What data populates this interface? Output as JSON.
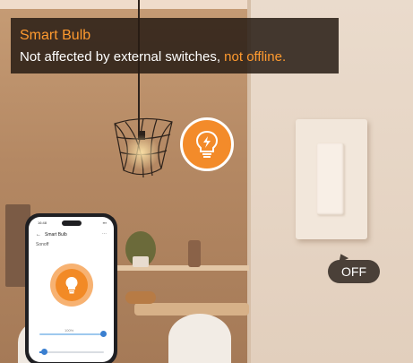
{
  "banner": {
    "title": "Smart Bulb",
    "subtitle_prefix": "Not affected by external switches, ",
    "subtitle_highlight": "not offline."
  },
  "phone": {
    "time": "16:48",
    "status": "▪▪▪",
    "back_glyph": "←",
    "title": "Smart Bulb",
    "menu_glyph": "⋯",
    "brand": "Sonoff",
    "slider_label": "100%"
  },
  "switch": {
    "state_label": "OFF"
  },
  "colors": {
    "accent": "#ff9a2f",
    "bulb_orange": "#f38b2a",
    "overlay": "#281c14",
    "tooltip": "#4a4038"
  },
  "icons": {
    "bulb_badge": "lightbulb-bolt-icon",
    "phone_bulb": "lightbulb-icon",
    "lamp": "pendant-lamp"
  }
}
